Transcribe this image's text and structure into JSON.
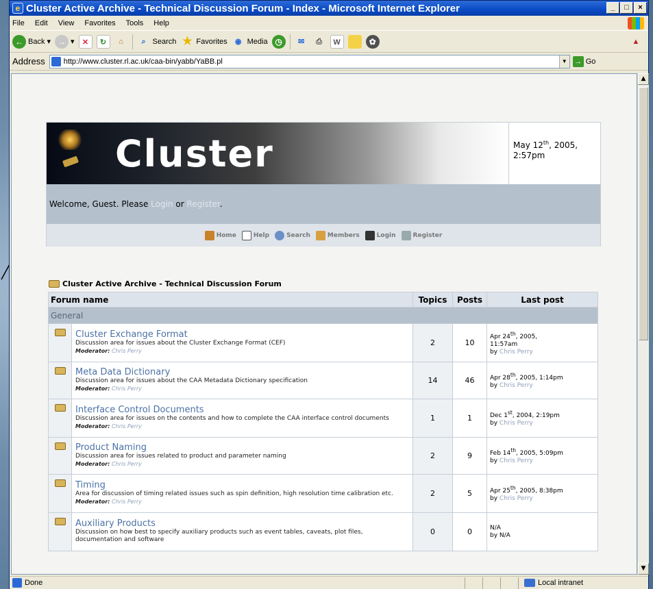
{
  "window": {
    "title": "Cluster Active Archive - Technical Discussion Forum - Index - Microsoft Internet Explorer",
    "menus": [
      "File",
      "Edit",
      "View",
      "Favorites",
      "Tools",
      "Help"
    ],
    "toolbar": {
      "back": "Back",
      "search": "Search",
      "favorites": "Favorites",
      "media": "Media"
    },
    "address_label": "Address",
    "url": "http://www.cluster.rl.ac.uk/caa-bin/yabb/YaBB.pl",
    "go": "Go",
    "status": "Done",
    "zone": "Local intranet"
  },
  "page": {
    "logo": "Cluster",
    "date": "May 12",
    "date_sup": "th",
    "date_rest": ", 2005,",
    "time": "2:57pm",
    "welcome": {
      "prefix": "Welcome, Guest. Please ",
      "login": "Login",
      "or": " or ",
      "register": "Register",
      "suffix": "."
    },
    "nav": [
      "Home",
      "Help",
      "Search",
      "Members",
      "Login",
      "Register"
    ],
    "forum_caption": "Cluster Active Archive - Technical Discussion Forum",
    "columns": {
      "name": "Forum name",
      "topics": "Topics",
      "posts": "Posts",
      "last": "Last post"
    },
    "category": "General",
    "moderator_label": "Moderator:",
    "boards": [
      {
        "name": "Cluster Exchange Format",
        "desc": "Discussion area for issues about the Cluster Exchange Format (CEF)",
        "moderator": "Chris Perry",
        "topics": "2",
        "posts": "10",
        "last_date": "Apr 24",
        "last_sup": "th",
        "last_rest": ", 2005,",
        "last_time": "11:57am",
        "by_label": "by",
        "by": "Chris Perry"
      },
      {
        "name": "Meta Data Dictionary",
        "desc": "Discussion area for issues about the CAA Metadata Dictionary specification",
        "moderator": "Chris Perry",
        "topics": "14",
        "posts": "46",
        "last_date": "Apr 28",
        "last_sup": "th",
        "last_rest": ", 2005, 1:14pm",
        "last_time": "",
        "by_label": "by",
        "by": "Chris Perry"
      },
      {
        "name": "Interface Control Documents",
        "desc": "Discussion area for issues on the contents and how to complete the CAA interface control documents",
        "moderator": "Chris Perry",
        "topics": "1",
        "posts": "1",
        "last_date": "Dec 1",
        "last_sup": "st",
        "last_rest": ", 2004, 2:19pm",
        "last_time": "",
        "by_label": "by",
        "by": "Chris Perry"
      },
      {
        "name": "Product Naming",
        "desc": "Discussion area for issues related to product and parameter naming",
        "moderator": "Chris Perry",
        "topics": "2",
        "posts": "9",
        "last_date": "Feb 14",
        "last_sup": "th",
        "last_rest": ", 2005, 5:09pm",
        "last_time": "",
        "by_label": "by",
        "by": "Chris Perry"
      },
      {
        "name": "Timing",
        "desc": "Area for discussion of timing related issues such as spin definition, high resolution time calibration etc.",
        "moderator": "Chris Perry",
        "topics": "2",
        "posts": "5",
        "last_date": "Apr 25",
        "last_sup": "th",
        "last_rest": ", 2005, 8:38pm",
        "last_time": "",
        "by_label": "by",
        "by": "Chris Perry"
      },
      {
        "name": "Auxiliary Products",
        "desc": "Discussion on how best to specify auxiliary products such as event tables, caveats, plot files, documentation and software",
        "moderator": "",
        "topics": "0",
        "posts": "0",
        "last_date": "N/A",
        "last_sup": "",
        "last_rest": "",
        "last_time": "",
        "by_label": "by",
        "by": "N/A"
      }
    ]
  }
}
